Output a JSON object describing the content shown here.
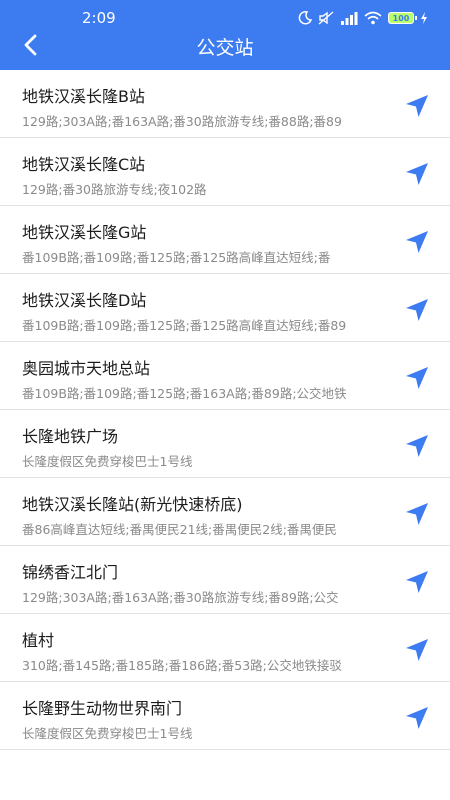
{
  "status_bar": {
    "time": "2:09",
    "battery": "100"
  },
  "header": {
    "title": "公交站"
  },
  "stations": [
    {
      "name": "地铁汉溪长隆B站",
      "routes": "129路;303A路;番163A路;番30路旅游专线;番88路;番89"
    },
    {
      "name": "地铁汉溪长隆C站",
      "routes": "129路;番30路旅游专线;夜102路"
    },
    {
      "name": "地铁汉溪长隆G站",
      "routes": "番109B路;番109路;番125路;番125路高峰直达短线;番"
    },
    {
      "name": "地铁汉溪长隆D站",
      "routes": "番109B路;番109路;番125路;番125路高峰直达短线;番89"
    },
    {
      "name": "奥园城市天地总站",
      "routes": "番109B路;番109路;番125路;番163A路;番89路;公交地铁"
    },
    {
      "name": "长隆地铁广场",
      "routes": "长隆度假区免费穿梭巴士1号线"
    },
    {
      "name": "地铁汉溪长隆站(新光快速桥底)",
      "routes": "番86高峰直达短线;番禺便民21线;番禺便民2线;番禺便民"
    },
    {
      "name": "锦绣香江北门",
      "routes": "129路;303A路;番163A路;番30路旅游专线;番89路;公交"
    },
    {
      "name": "植村",
      "routes": "310路;番145路;番185路;番186路;番53路;公交地铁接驳"
    },
    {
      "name": "长隆野生动物世界南门",
      "routes": "长隆度假区免费穿梭巴士1号线"
    }
  ],
  "colors": {
    "header": "#3d7bf0",
    "nav_icon": "#3d7bf0"
  }
}
